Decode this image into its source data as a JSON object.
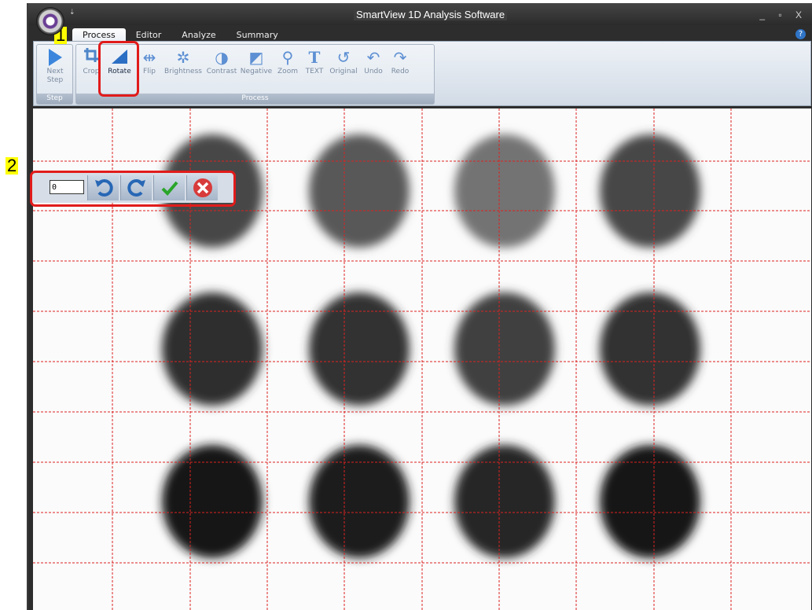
{
  "window": {
    "title": "SmartView 1D Analysis Software",
    "controls": "_ ▫ X",
    "quick_access": "⇣"
  },
  "tabs": [
    "Process",
    "Editor",
    "Analyze",
    "Summary"
  ],
  "help_label": "?",
  "ribbon": {
    "step_group": {
      "label": "Step",
      "buttons": [
        {
          "label_line1": "Next",
          "label_line2": "Step"
        }
      ]
    },
    "process_group": {
      "label": "Process",
      "buttons": [
        "Crop",
        "Rotate",
        "Flip",
        "Brightness",
        "Contrast",
        "Negative",
        "Zoom",
        "TEXT",
        "Original",
        "Undo",
        "Redo"
      ]
    }
  },
  "annotations": {
    "callout1": "1",
    "callout2": "2"
  },
  "rotate_toolbar": {
    "angle_value": "0"
  },
  "colors": {
    "accent_red": "#e11b1b",
    "callout_yellow": "#ffff00",
    "grid_red": "#dd2222"
  },
  "image": {
    "rows": 3,
    "cols": 4,
    "dot_darkness": [
      [
        0.72,
        0.65,
        0.55,
        0.72
      ],
      [
        0.82,
        0.8,
        0.75,
        0.8
      ],
      [
        0.9,
        0.88,
        0.85,
        0.9
      ]
    ]
  }
}
